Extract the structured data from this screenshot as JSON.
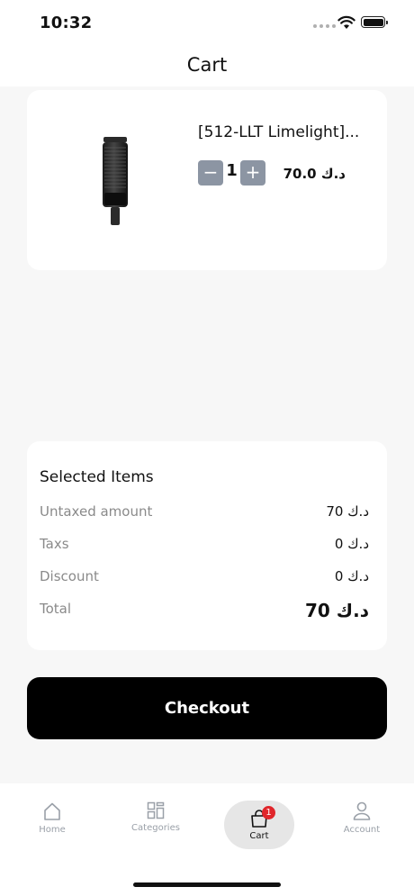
{
  "status_bar": {
    "time": "10:32"
  },
  "header": {
    "title": "Cart"
  },
  "cart_item": {
    "name": "[512-LLT Limelight]...",
    "quantity": "1",
    "minus_label": "−",
    "plus_label": "+",
    "price": "70.0 د.ك",
    "image_icon": "microphone"
  },
  "summary": {
    "title": "Selected Items",
    "rows": [
      {
        "label": "Untaxed amount",
        "value": "70 د.ك"
      },
      {
        "label": "Taxs",
        "value": "0 د.ك"
      },
      {
        "label": "Discount",
        "value": "0 د.ك"
      },
      {
        "label": "Total",
        "value": "70 د.ك"
      }
    ]
  },
  "checkout": {
    "label": "Checkout"
  },
  "tab_bar": {
    "items": [
      {
        "label": "Home",
        "icon": "home-icon"
      },
      {
        "label": "Categories",
        "icon": "grid-icon"
      },
      {
        "label": "Cart",
        "icon": "bag-icon",
        "badge": "1",
        "active": true
      },
      {
        "label": "Account",
        "icon": "user-icon"
      }
    ]
  },
  "colors": {
    "accent": "#000000",
    "badge": "#e0262b",
    "qty_button": "#8c95a3",
    "inactive_tab": "#9aa0a8"
  }
}
